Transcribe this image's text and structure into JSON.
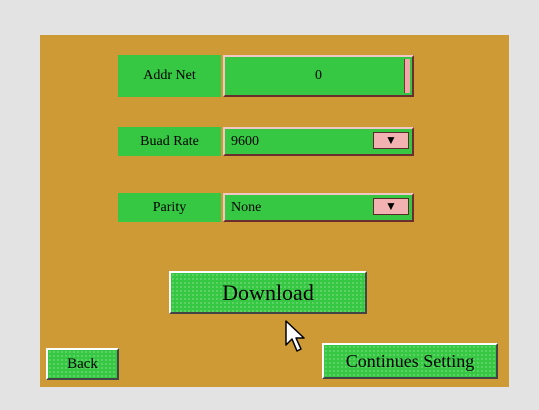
{
  "form": {
    "addr_net": {
      "label": "Addr Net",
      "value": "0"
    },
    "baud_rate": {
      "label": "Buad Rate",
      "value": "9600"
    },
    "parity": {
      "label": "Parity",
      "value": "None"
    }
  },
  "buttons": {
    "download": "Download",
    "back": "Back",
    "continue": "Continues Setting"
  },
  "icons": {
    "dropdown": "chevron-down-icon",
    "cursor": "mouse-pointer-icon"
  },
  "colors": {
    "panel": "#cd9a36",
    "background": "#e3e3e3",
    "field_green": "#36c843",
    "dropdown_pink": "#f2b2b2"
  }
}
